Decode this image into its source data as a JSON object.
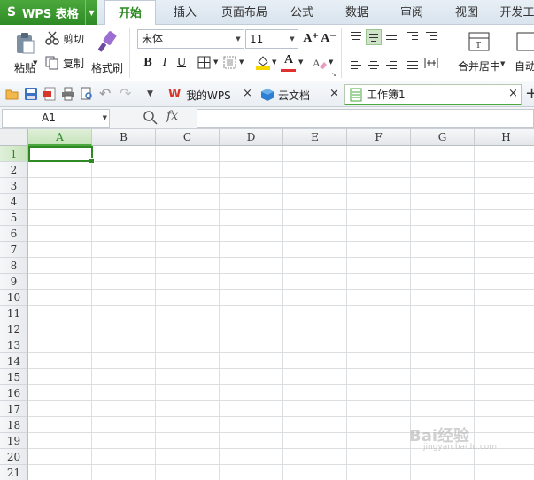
{
  "app": {
    "name": "WPS 表格"
  },
  "menu_tabs": [
    "开始",
    "插入",
    "页面布局",
    "公式",
    "数据",
    "审阅",
    "视图",
    "开发工"
  ],
  "active_menu_tab": "开始",
  "ribbon": {
    "paste": "粘贴",
    "cut": "剪切",
    "copy": "复制",
    "format_painter": "格式刷",
    "font_name": "宋体",
    "font_size": "11",
    "bold": "B",
    "italic": "I",
    "underline": "U",
    "font_color_letter": "A",
    "font_color": "#e03030",
    "fill_color": "#f5d800",
    "increase_font": "A⁺",
    "decrease_font": "A⁻",
    "merge_center": "合并居中",
    "wrap": "自动"
  },
  "doc_tabs": [
    {
      "label": "我的WPS",
      "icon": "wps-logo-icon",
      "color": "#d9362b"
    },
    {
      "label": "云文档",
      "icon": "cloud-cube-icon",
      "color": "#2e7fd3"
    },
    {
      "label": "工作簿1",
      "icon": "spreadsheet-doc-icon",
      "color": "#4aa83c"
    }
  ],
  "formula_bar": {
    "cell_ref": "A1",
    "fx": "fx",
    "value": ""
  },
  "columns": [
    "A",
    "B",
    "C",
    "D",
    "E",
    "F",
    "G",
    "H"
  ],
  "rows": [
    "1",
    "2",
    "3",
    "4",
    "5",
    "6",
    "7",
    "8",
    "9",
    "10",
    "11",
    "12",
    "13",
    "14",
    "15",
    "16",
    "17",
    "18",
    "19",
    "20",
    "21"
  ],
  "selected_cell": "A1",
  "watermark": {
    "text": "Bai经验",
    "sub": "jingyan.baidu.com"
  },
  "accent_color": "#2f8a25"
}
